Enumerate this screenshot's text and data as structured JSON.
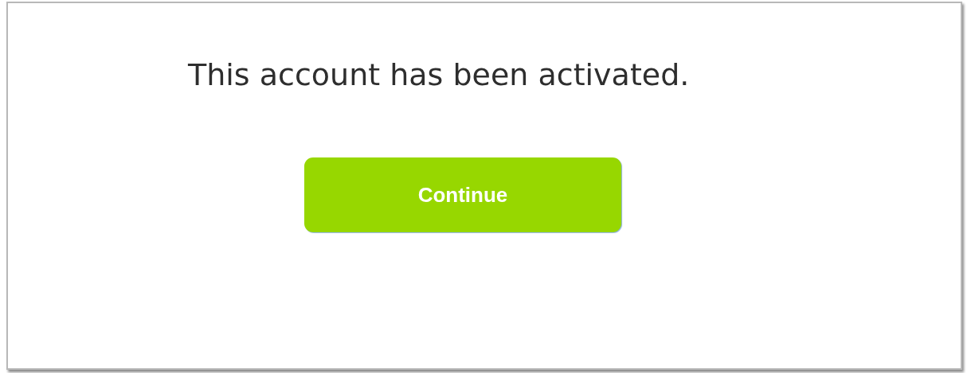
{
  "message": "This account has been activated.",
  "button": {
    "label": "Continue"
  }
}
